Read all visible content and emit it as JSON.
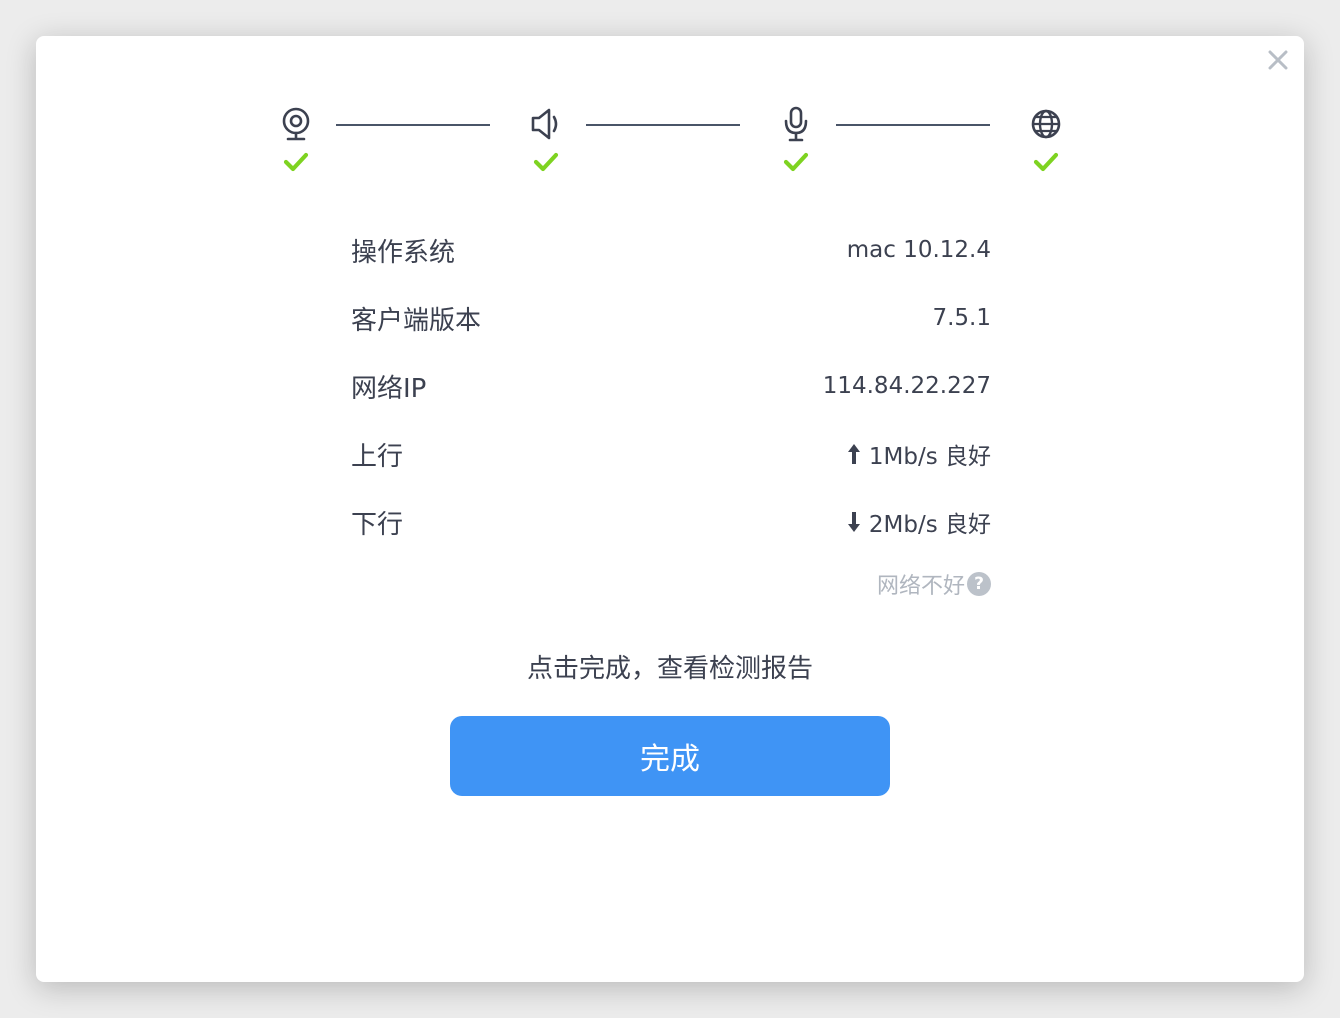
{
  "steps": [
    {
      "icon": "webcam-icon",
      "status": "check-icon"
    },
    {
      "icon": "speaker-icon",
      "status": "check-icon"
    },
    {
      "icon": "microphone-icon",
      "status": "check-icon"
    },
    {
      "icon": "globe-icon",
      "status": "check-icon"
    }
  ],
  "info": {
    "os_label": "操作系统",
    "os_value": "mac 10.12.4",
    "client_label": "客户端版本",
    "client_value": "7.5.1",
    "ip_label": "网络IP",
    "ip_value": "114.84.22.227",
    "up_label": "上行",
    "up_value": "1Mb/s 良好",
    "down_label": "下行",
    "down_value": "2Mb/s 良好"
  },
  "network_bad_link": "网络不好",
  "help_glyph": "?",
  "hint": "点击完成，查看检测报告",
  "done_button": "完成",
  "colors": {
    "accent": "#3f94f5",
    "success": "#7ed321",
    "text": "#3c4150",
    "muted": "#b0b6bf"
  }
}
